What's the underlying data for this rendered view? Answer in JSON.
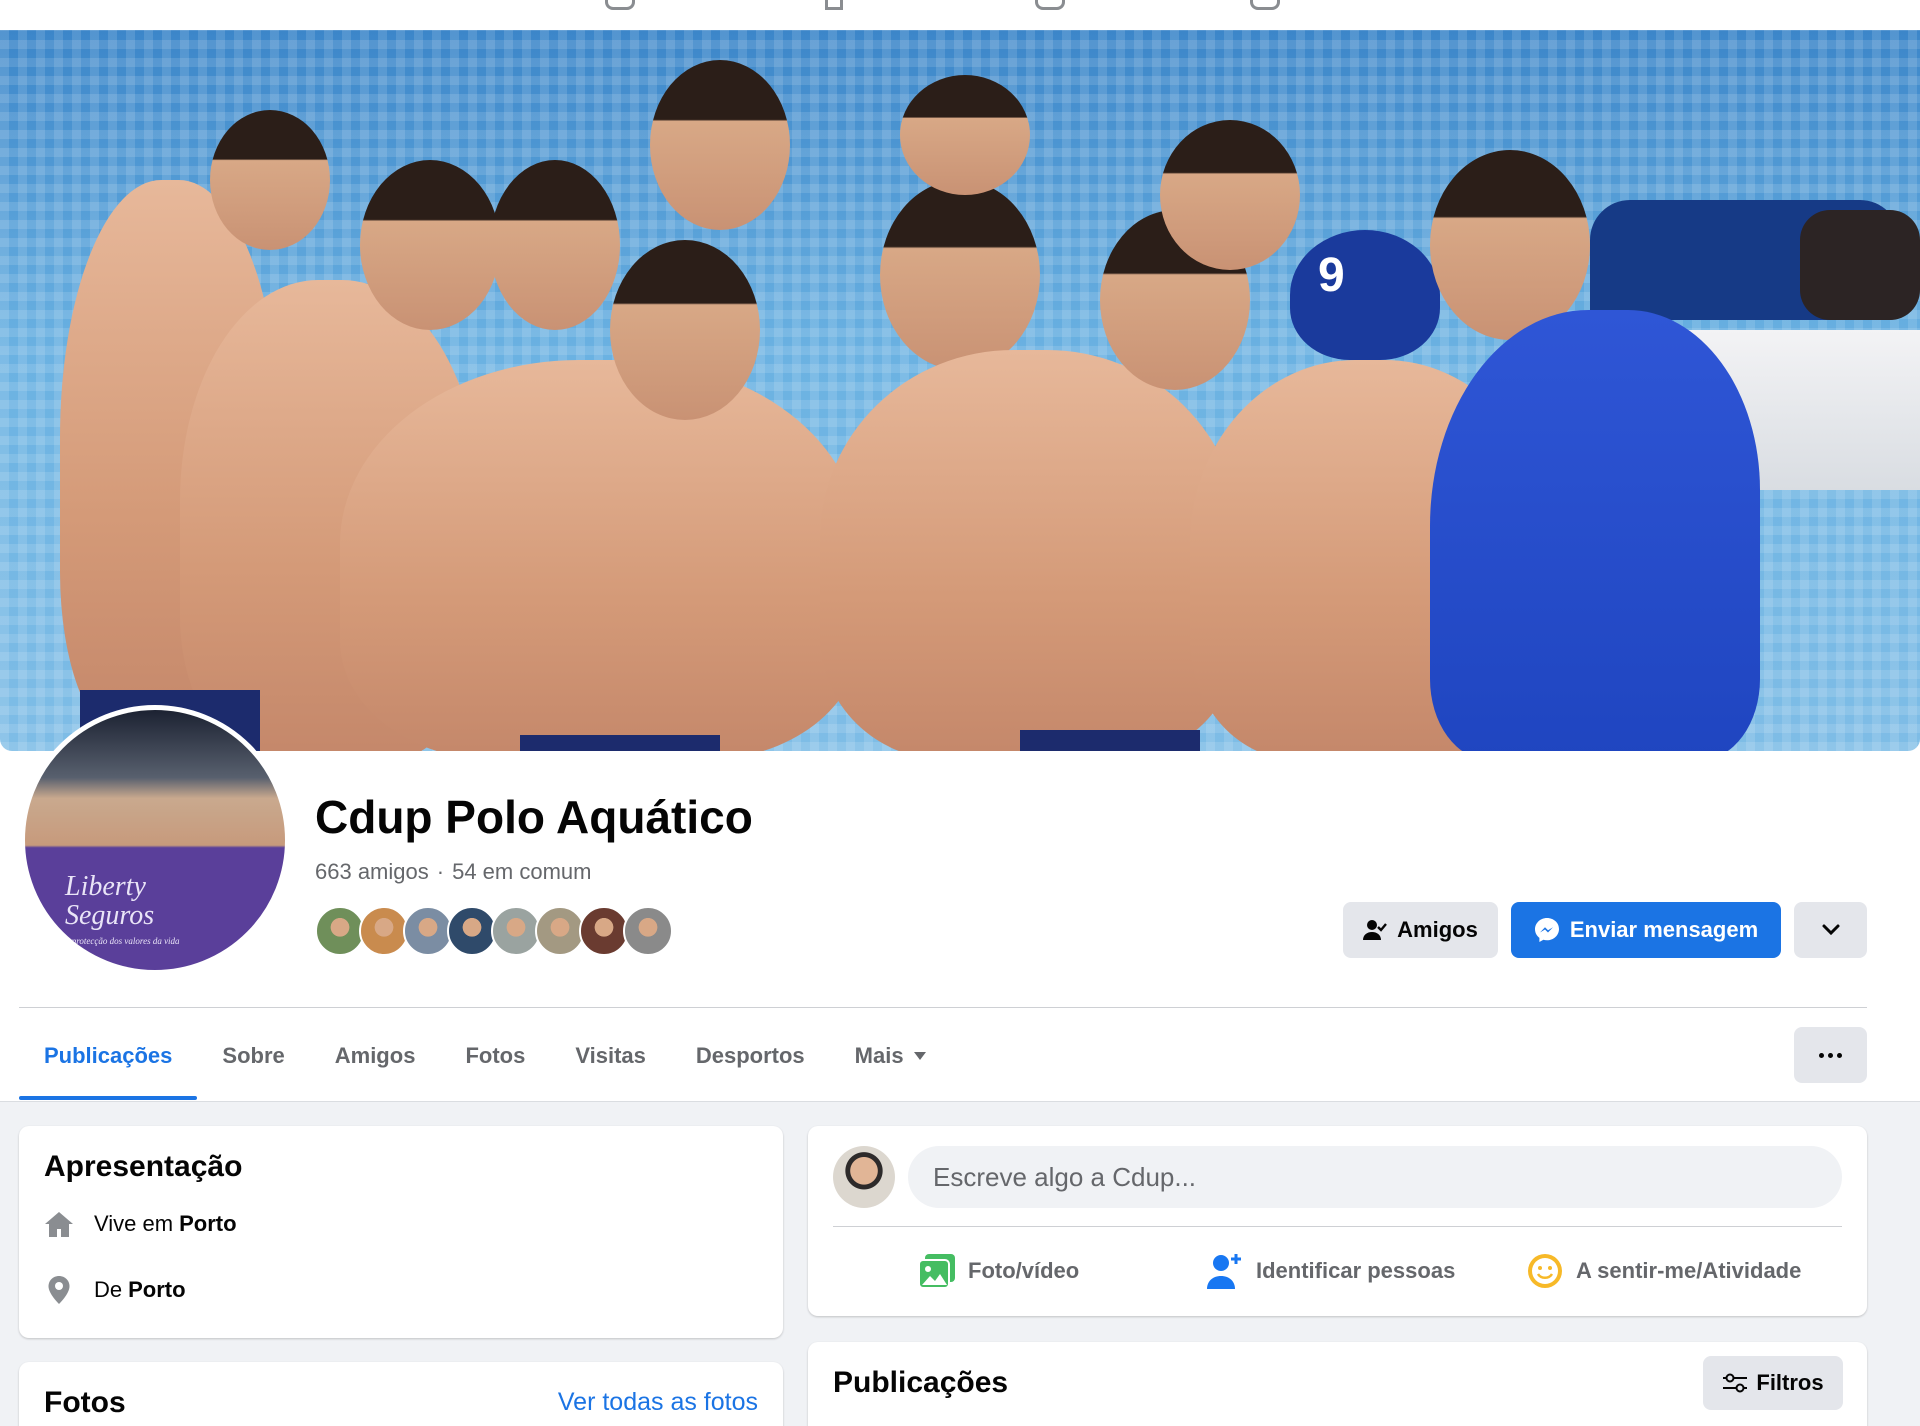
{
  "profile": {
    "name": "Cdup Polo Aquático",
    "friends_count": "663 amigos",
    "separator": "·",
    "mutual_count": "54 em comum",
    "mutual_friends": [
      {
        "color": "#6f8f5a"
      },
      {
        "color": "#c98b4e"
      },
      {
        "color": "#7b8da3"
      },
      {
        "color": "#2f4a6a"
      },
      {
        "color": "#9aa3a0"
      },
      {
        "color": "#a39982"
      },
      {
        "color": "#6a3b30"
      },
      {
        "color": "#8a8a8a"
      }
    ],
    "avatar_banner_line1": "Liberty",
    "avatar_banner_line2": "Seguros",
    "avatar_banner_tagline": "a protecção dos valores da vida"
  },
  "actions": {
    "friends_label": "Amigos",
    "message_label": "Enviar mensagem"
  },
  "tabs": [
    {
      "label": "Publicações",
      "active": true
    },
    {
      "label": "Sobre"
    },
    {
      "label": "Amigos"
    },
    {
      "label": "Fotos"
    },
    {
      "label": "Visitas"
    },
    {
      "label": "Desportos"
    },
    {
      "label": "Mais",
      "dropdown": true
    }
  ],
  "intro": {
    "title": "Apresentação",
    "lives_prefix": "Vive em",
    "lives_city": "Porto",
    "from_prefix": "De",
    "from_city": "Porto"
  },
  "photos": {
    "title": "Fotos",
    "see_all": "Ver todas as fotos"
  },
  "composer": {
    "placeholder": "Escreve algo a Cdup...",
    "photo_video": "Foto/vídeo",
    "tag_people": "Identificar pessoas",
    "feeling": "A sentir-me/Atividade"
  },
  "posts": {
    "title": "Publicações",
    "filters": "Filtros"
  },
  "colors": {
    "accent": "#1b74e4",
    "photo_icon": "#45bd62",
    "tag_icon": "#1877f2",
    "feeling_icon": "#f7b928"
  },
  "icons": {
    "cover_cap_number": "9"
  }
}
